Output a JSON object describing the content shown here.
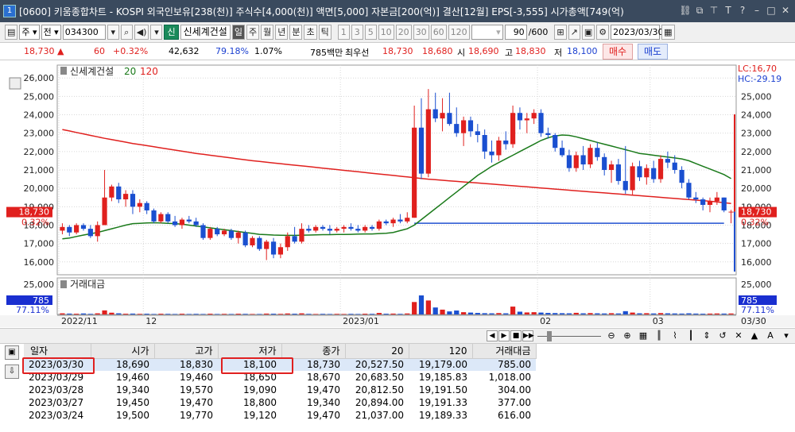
{
  "window": {
    "badge": "1",
    "title": "[0600] 키움종합차트 - KOSPI 외국인보유[238(천)] 주식수[4,000(천)] 액면[5,000] 자본금[200(억)] 결산[12월] EPS[-3,555] 시가총액[749(억)"
  },
  "toolbar": {
    "period_a": "주",
    "period_b": "전",
    "code": "034300",
    "sin_badge": "신",
    "stock_name": "신세계건설",
    "periods": [
      "일",
      "주",
      "월",
      "년",
      "분",
      "초",
      "틱"
    ],
    "active_period": "일",
    "intervals": [
      "1",
      "3",
      "5",
      "10",
      "20",
      "30",
      "60",
      "120"
    ],
    "count_value": "90",
    "count_total": "/600",
    "date_value": "2023/03/30"
  },
  "quote": {
    "price": "18,730",
    "change": "60",
    "change_pct": "+0.32%",
    "volume": "42,632",
    "vol_ratio": "79.18%",
    "turnover": "1.07%",
    "amount": "785백만",
    "label_best": "최우선",
    "best_ask": "18,730",
    "best_bid": "18,680",
    "label_open": "시",
    "open": "18,690",
    "label_high": "고",
    "high": "18,830",
    "label_low": "저",
    "low": "18,100",
    "buy_label": "매수",
    "sell_label": "매도"
  },
  "chart_data": {
    "type": "candlestick",
    "legend_name": "신세계건설",
    "ma_periods": [
      "20",
      "120"
    ],
    "colors": {
      "up": "#e0201e",
      "down": "#1a4fd0",
      "ma20": "#1a7a1a",
      "ma120": "#e0201e",
      "hline": "#2050d0"
    },
    "y_ticks": [
      16000,
      17000,
      18000,
      19000,
      20000,
      21000,
      22000,
      23000,
      24000,
      25000,
      26000
    ],
    "y_tick_labels": [
      "16,000",
      "17,000",
      "18,000",
      "19,000",
      "20,000",
      "21,000",
      "22,000",
      "23,000",
      "24,000",
      "25,000",
      "26,000"
    ],
    "right_tick_labels": [
      "16,000",
      "17,000",
      "18,000",
      "19,000",
      "20,000",
      "21,000",
      "22,000",
      "23,000",
      "24,000",
      "25,000"
    ],
    "ylim": [
      15300,
      26700
    ],
    "lc": "LC:16,70",
    "hc": "HC:-29.19",
    "current_price": "18,730",
    "current_pct": "0.32%",
    "horizontal_line": 18100,
    "x_labels": [
      "2022/11",
      "12",
      "2023/01",
      "02",
      "03"
    ],
    "x_end_label": "03/30",
    "ohlc": [
      [
        17700,
        18100,
        17500,
        17900
      ],
      [
        17900,
        18000,
        17400,
        17600
      ],
      [
        17600,
        18100,
        17500,
        18000
      ],
      [
        18000,
        18100,
        17700,
        17800
      ],
      [
        17800,
        18000,
        17300,
        17400
      ],
      [
        17400,
        18200,
        17100,
        18000
      ],
      [
        18000,
        21000,
        18000,
        19500
      ],
      [
        19500,
        20200,
        19300,
        20100
      ],
      [
        20100,
        20300,
        19200,
        19400
      ],
      [
        19400,
        19900,
        19000,
        19700
      ],
      [
        19700,
        19900,
        18600,
        19000
      ],
      [
        19000,
        19400,
        18700,
        19200
      ],
      [
        19200,
        19300,
        18600,
        18800
      ],
      [
        18800,
        18900,
        18100,
        18200
      ],
      [
        18200,
        18700,
        18100,
        18600
      ],
      [
        18600,
        18700,
        18100,
        18200
      ],
      [
        18200,
        18500,
        17900,
        18000
      ],
      [
        18000,
        18400,
        17800,
        18300
      ],
      [
        18300,
        18500,
        18100,
        18200
      ],
      [
        18200,
        18400,
        17900,
        18000
      ],
      [
        18000,
        18100,
        17200,
        17300
      ],
      [
        17300,
        17900,
        17200,
        17800
      ],
      [
        17800,
        17900,
        17400,
        17500
      ],
      [
        17500,
        17800,
        17400,
        17700
      ],
      [
        17700,
        17800,
        17200,
        17300
      ],
      [
        17300,
        17700,
        17000,
        17600
      ],
      [
        17600,
        17700,
        16800,
        16900
      ],
      [
        16900,
        17400,
        16800,
        17300
      ],
      [
        17300,
        17400,
        16600,
        16700
      ],
      [
        16700,
        17200,
        16100,
        17100
      ],
      [
        17100,
        17300,
        16200,
        16400
      ],
      [
        16400,
        17000,
        16200,
        16800
      ],
      [
        16800,
        17600,
        16600,
        17400
      ],
      [
        17400,
        17900,
        17000,
        17100
      ],
      [
        17100,
        18100,
        17000,
        17800
      ],
      [
        17800,
        18000,
        17600,
        17700
      ],
      [
        17700,
        18000,
        17600,
        17900
      ],
      [
        17900,
        18000,
        17700,
        17800
      ],
      [
        17800,
        18000,
        17500,
        17700
      ],
      [
        17700,
        17900,
        17600,
        17800
      ],
      [
        17800,
        18000,
        17600,
        17900
      ],
      [
        17900,
        18100,
        17700,
        17800
      ],
      [
        17800,
        18000,
        17600,
        17700
      ],
      [
        17700,
        18000,
        17600,
        17900
      ],
      [
        17900,
        18000,
        17700,
        17800
      ],
      [
        17800,
        18300,
        17700,
        18200
      ],
      [
        18200,
        18300,
        18000,
        18100
      ],
      [
        18100,
        18400,
        17900,
        18300
      ],
      [
        18300,
        18600,
        18100,
        18200
      ],
      [
        18200,
        18700,
        18100,
        18400
      ],
      [
        18400,
        24500,
        18400,
        23300
      ],
      [
        23300,
        24900,
        20500,
        20800
      ],
      [
        20800,
        25400,
        20600,
        24300
      ],
      [
        24300,
        25200,
        23600,
        23800
      ],
      [
        23800,
        24900,
        23100,
        24100
      ],
      [
        24100,
        25200,
        23400,
        23500
      ],
      [
        23500,
        24400,
        22800,
        23000
      ],
      [
        23000,
        23900,
        22300,
        23700
      ],
      [
        23700,
        23900,
        22800,
        23100
      ],
      [
        23100,
        23500,
        22500,
        22900
      ],
      [
        22900,
        23200,
        21600,
        22000
      ],
      [
        22000,
        22600,
        21400,
        21800
      ],
      [
        21800,
        22800,
        21500,
        22600
      ],
      [
        22600,
        23100,
        22100,
        22400
      ],
      [
        22400,
        24500,
        22200,
        24100
      ],
      [
        24100,
        24400,
        23200,
        23700
      ],
      [
        23700,
        24100,
        23000,
        23800
      ],
      [
        23800,
        24300,
        23500,
        24100
      ],
      [
        24100,
        24300,
        22800,
        23000
      ],
      [
        23000,
        23300,
        22700,
        22900
      ],
      [
        22900,
        23000,
        22000,
        22200
      ],
      [
        22200,
        22600,
        21700,
        21800
      ],
      [
        21800,
        22100,
        20900,
        21100
      ],
      [
        21100,
        22000,
        20900,
        21800
      ],
      [
        21800,
        22300,
        21000,
        21300
      ],
      [
        21300,
        22400,
        21100,
        22200
      ],
      [
        22200,
        22500,
        21500,
        21700
      ],
      [
        21700,
        21900,
        20700,
        21000
      ],
      [
        21000,
        21500,
        20300,
        21300
      ],
      [
        21300,
        21600,
        20200,
        20400
      ],
      [
        20400,
        22300,
        19700,
        19900
      ],
      [
        19900,
        21400,
        19600,
        21200
      ],
      [
        21200,
        21500,
        20400,
        20600
      ],
      [
        20600,
        21300,
        20200,
        21100
      ],
      [
        21100,
        21500,
        20300,
        20500
      ],
      [
        20500,
        21800,
        20300,
        21600
      ],
      [
        21600,
        22000,
        21100,
        21400
      ],
      [
        21400,
        21800,
        20800,
        21000
      ],
      [
        21000,
        21200,
        20000,
        20300
      ],
      [
        20300,
        20500,
        19400,
        19500
      ],
      [
        19500,
        19800,
        19200,
        19400
      ],
      [
        19400,
        19500,
        18800,
        19100
      ],
      [
        19100,
        19500,
        18700,
        19300
      ],
      [
        19300,
        19800,
        19100,
        19500
      ],
      [
        19500,
        19500,
        18700,
        18800
      ],
      [
        18690,
        18830,
        18100,
        18730
      ]
    ],
    "ma20": [
      17250,
      17300,
      17380,
      17460,
      17530,
      17600,
      17700,
      17800,
      17900,
      18000,
      18080,
      18100,
      18120,
      18130,
      18120,
      18100,
      18080,
      18050,
      18000,
      17950,
      17900,
      17850,
      17800,
      17750,
      17700,
      17650,
      17600,
      17550,
      17500,
      17480,
      17460,
      17450,
      17440,
      17440,
      17450,
      17460,
      17470,
      17480,
      17480,
      17490,
      17490,
      17500,
      17510,
      17520,
      17520,
      17540,
      17560,
      17600,
      17700,
      17800,
      18000,
      18300,
      18600,
      18900,
      19200,
      19500,
      19800,
      20100,
      20400,
      20700,
      20950,
      21200,
      21400,
      21600,
      21800,
      22000,
      22200,
      22400,
      22600,
      22750,
      22850,
      22900,
      22880,
      22800,
      22700,
      22600,
      22500,
      22400,
      22300,
      22200,
      22100,
      22000,
      21900,
      21850,
      21800,
      21750,
      21700,
      21650,
      21600,
      21500,
      21350,
      21200,
      21050,
      20900,
      20750,
      20530
    ],
    "ma120": [
      23200,
      23120,
      23040,
      22960,
      22880,
      22800,
      22720,
      22650,
      22580,
      22510,
      22440,
      22380,
      22320,
      22260,
      22200,
      22140,
      22080,
      22020,
      21960,
      21900,
      21850,
      21800,
      21750,
      21700,
      21650,
      21600,
      21550,
      21500,
      21460,
      21420,
      21380,
      21340,
      21300,
      21260,
      21220,
      21180,
      21140,
      21100,
      21060,
      21020,
      20980,
      20940,
      20900,
      20860,
      20820,
      20780,
      20740,
      20700,
      20660,
      20620,
      20580,
      20540,
      20500,
      20470,
      20440,
      20410,
      20380,
      20350,
      20320,
      20290,
      20260,
      20230,
      20200,
      20170,
      20140,
      20110,
      20080,
      20050,
      20020,
      19990,
      19960,
      19930,
      19900,
      19870,
      19840,
      19810,
      19780,
      19750,
      19720,
      19690,
      19660,
      19630,
      19600,
      19570,
      19540,
      19510,
      19480,
      19450,
      19420,
      19390,
      19360,
      19330,
      19300,
      19260,
      19220,
      19179
    ],
    "volume_panel": {
      "title": "거래대금",
      "y_label": "25,000",
      "right_y_label": "25,000",
      "cur_value": "785",
      "cur_pct": "77.11%",
      "values": [
        900,
        700,
        600,
        800,
        500,
        900,
        3200,
        1400,
        900,
        600,
        700,
        500,
        600,
        400,
        600,
        500,
        400,
        600,
        400,
        500,
        400,
        600,
        400,
        500,
        400,
        600,
        500,
        400,
        400,
        700,
        600,
        500,
        800,
        600,
        900,
        500,
        400,
        500,
        400,
        500,
        400,
        500,
        400,
        600,
        500,
        1200,
        600,
        700,
        500,
        800,
        9800,
        15000,
        11000,
        5500,
        3800,
        2400,
        3100,
        1800,
        1500,
        1200,
        1000,
        900,
        1100,
        900,
        6200,
        2200,
        1600,
        1800,
        1500,
        1200,
        1100,
        1000,
        900,
        1300,
        900,
        1100,
        900,
        800,
        1000,
        800,
        2600,
        1500,
        900,
        1000,
        800,
        1100,
        900,
        800,
        700,
        900,
        700,
        600,
        700,
        800,
        700,
        785
      ]
    }
  },
  "table": {
    "headers": [
      "일자",
      "시가",
      "고가",
      "저가",
      "종가",
      "20",
      "120",
      "거래대금"
    ],
    "rows": [
      [
        "2023/03/30",
        "18,690",
        "18,830",
        "18,100",
        "18,730",
        "20,527.50",
        "19,179.00",
        "785.00"
      ],
      [
        "2023/03/29",
        "19,460",
        "19,460",
        "18,650",
        "18,670",
        "20,683.50",
        "19,185.83",
        "1,018.00"
      ],
      [
        "2023/03/28",
        "19,340",
        "19,570",
        "19,090",
        "19,470",
        "20,812.50",
        "19,191.50",
        "304.00"
      ],
      [
        "2023/03/27",
        "19,450",
        "19,470",
        "18,800",
        "19,340",
        "20,894.00",
        "19,191.33",
        "377.00"
      ],
      [
        "2023/03/24",
        "19,500",
        "19,770",
        "19,120",
        "19,470",
        "21,037.00",
        "19,189.33",
        "616.00"
      ]
    ]
  }
}
